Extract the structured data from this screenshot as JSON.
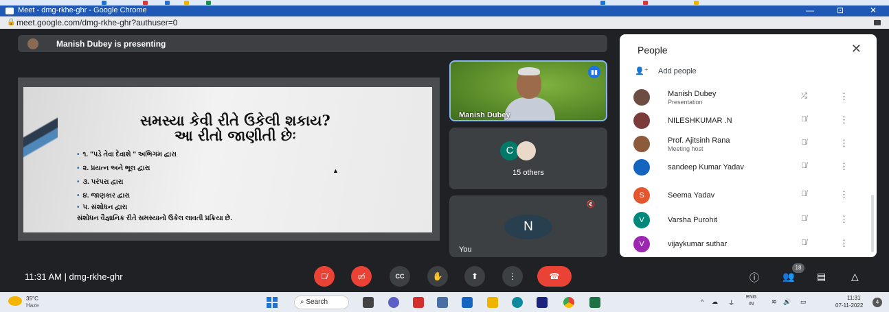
{
  "browser": {
    "title": "Meet - dmg-rkhe-ghr - Google Chrome",
    "url": "meet.google.com/dmg-rkhe-ghr?authuser=0",
    "win_min": "—",
    "win_max": "⊡",
    "win_close": "✕"
  },
  "presenting": {
    "label": "Manish Dubey is presenting"
  },
  "slide": {
    "title_line1": "સમસ્યા કેવી રીતે ઉકેલી શકાય?",
    "title_line2": "આ રીતો જાણીતી છેઃ",
    "bullets": [
      "૧. \"પડે તેવા દેવાશે \" અભિગમ દ્વારા",
      "૨. પ્રયત્ન અને ભૂલ દ્વારા",
      "૩. પરંપરા દ્વારા",
      "૪. જાણકાર દ્વારા",
      "૫. સંશોધન દ્વારા"
    ],
    "conclusion": "સંશોધન વૈજ્ઞાનિક રીતે સમસ્યાનો ઉકેલ લાવતી પ્રક્રિયા છે."
  },
  "tiles": {
    "presenter_name": "Manish Dubey",
    "others_initial": "C",
    "others_count": "15 others",
    "you_initial": "N",
    "you_label": "You"
  },
  "people": {
    "title": "People",
    "close": "✕",
    "add_people": "Add people",
    "participants": [
      {
        "name": "Manish Dubey",
        "subtitle": "Presentation",
        "initial": "",
        "color": "#6d4c41"
      },
      {
        "name": "NILESHKUMAR .N",
        "subtitle": "",
        "initial": "",
        "color": "#7b3b3b"
      },
      {
        "name": "Prof. Ajitsinh Rana",
        "subtitle": "Meeting host",
        "initial": "",
        "color": "#8d5a3b"
      },
      {
        "name": "sandeep Kumar Yadav",
        "subtitle": "",
        "initial": "",
        "color": "#1565c0"
      },
      {
        "name": "Seema Yadav",
        "subtitle": "",
        "initial": "S",
        "color": "#e4572e"
      },
      {
        "name": "Varsha Purohit",
        "subtitle": "",
        "initial": "V",
        "color": "#00897b"
      },
      {
        "name": "vijaykumar suthar",
        "subtitle": "",
        "initial": "V",
        "color": "#9c27b0"
      }
    ],
    "more_glyph": "⋮",
    "mic_glyph": "🎙"
  },
  "controls": {
    "time_meeting": "11:31 AM  |  dmg-rkhe-ghr",
    "participants_badge": "18",
    "cc_label": "CC"
  },
  "taskbar": {
    "temp": "35°C",
    "weather": "Haze",
    "search": "Search",
    "lang1": "ENG",
    "lang2": "IN",
    "time": "11:31",
    "date": "07-11-2022",
    "notifications": "4"
  }
}
